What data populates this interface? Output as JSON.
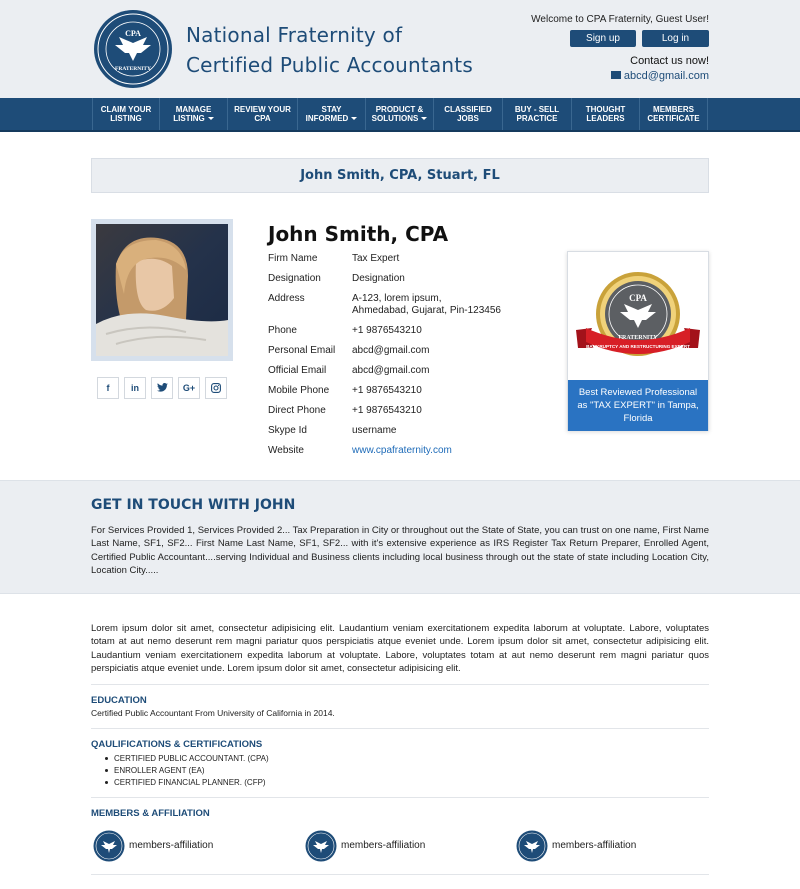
{
  "header": {
    "site_title_line1": "National Fraternity of",
    "site_title_line2": "Certified Public Accountants",
    "welcome": "Welcome to CPA Fraternity, Guest User!",
    "signup_label": "Sign up",
    "login_label": "Log in",
    "contact_label": "Contact us now!",
    "email": "abcd@gmail.com",
    "logo_text_top": "CPA",
    "logo_text_bottom": "FRATERNITY"
  },
  "nav": {
    "items": [
      {
        "l1": "CLAIM YOUR",
        "l2": "LISTING"
      },
      {
        "l1": "MANAGE",
        "l2": "LISTING"
      },
      {
        "l1": "REVIEW YOUR",
        "l2": "CPA"
      },
      {
        "l1": "STAY",
        "l2": "INFORMED"
      },
      {
        "l1": "PRODUCT &",
        "l2": "SOLUTIONS"
      },
      {
        "l1": "CLASSIFIED",
        "l2": "JOBS"
      },
      {
        "l1": "BUY - SELL",
        "l2": "PRACTICE"
      },
      {
        "l1": "THOUGHT",
        "l2": "LEADERS"
      },
      {
        "l1": "MEMBERS",
        "l2": "CERTIFICATE"
      }
    ]
  },
  "banner": {
    "title": "John Smith, CPA, Stuart, FL"
  },
  "profile": {
    "name": "John Smith, CPA",
    "socials": [
      "f",
      "in",
      "t",
      "G+",
      "ig"
    ],
    "fields": [
      {
        "label": "Firm Name",
        "value": "Tax Expert"
      },
      {
        "label": "Designation",
        "value": "Designation"
      },
      {
        "label": "Address",
        "value": "A-123, lorem ipsum,",
        "value2": "Ahmedabad, Gujarat, Pin-123456"
      },
      {
        "label": "Phone",
        "value": "+1 9876543210"
      },
      {
        "label": "Personal Email",
        "value": "abcd@gmail.com"
      },
      {
        "label": "Official Email",
        "value": "abcd@gmail.com"
      },
      {
        "label": "Mobile Phone",
        "value": "+1 9876543210"
      },
      {
        "label": "Direct Phone",
        "value": "+1 9876543210"
      },
      {
        "label": "Skype Id",
        "value": "username"
      },
      {
        "label": "Website",
        "value": "www.cpafraternity.com"
      }
    ]
  },
  "badge": {
    "text": "Best Reviewed Professional as \"TAX EXPERT\" in Tampa, Florida",
    "ribbon_text": "BANKRUPTCY AND RESTRUCTURING EXPERT",
    "seal_top": "CPA",
    "seal_bottom": "FRATERNITY"
  },
  "touch": {
    "title": "GET IN TOUCH WITH JOHN",
    "text": "For Services Provided 1, Services Provided 2... Tax Preparation in City or throughout out the State of State, you can trust on one name, First Name Last Name, SF1, SF2... First Name Last Name, SF1, SF2... with it's extensive experience as IRS Register Tax Return Preparer, Enrolled Agent, Certified Public Accountant....serving Individual and Business clients including local business through out the state of state including Location City, Location City....."
  },
  "about": {
    "text": "Lorem ipsum dolor sit amet, consectetur adipisicing elit. Laudantium veniam exercitationem expedita laborum at voluptate. Labore, voluptates totam at aut nemo deserunt rem magni pariatur quos perspiciatis atque eveniet unde. Lorem ipsum dolor sit amet, consectetur adipisicing elit. Laudantium veniam exercitationem expedita laborum at voluptate. Labore, voluptates totam at aut nemo deserunt rem magni pariatur quos perspiciatis atque eveniet unde. Lorem ipsum dolor sit amet, consectetur adipisicing elit."
  },
  "education": {
    "title": "EDUCATION",
    "text": "Certified Public Accountant From University of California in 2014."
  },
  "qualifications": {
    "title": "QAULIFICATIONS & CERTIFICATIONS",
    "items": [
      "CERTIFIED PUBLIC ACCOUNTANT. (CPA)",
      "ENROLLER AGENT (EA)",
      "CERTIFIED FINANCIAL PLANNER. (CFP)"
    ]
  },
  "members": {
    "title": "MEMBERS & AFFILIATION",
    "items": [
      "members-affiliation",
      "members-affiliation",
      "members-affiliation"
    ]
  },
  "colors": {
    "brand": "#1e4c78",
    "accent": "#2a73c2",
    "bg_light": "#ebeef2"
  }
}
